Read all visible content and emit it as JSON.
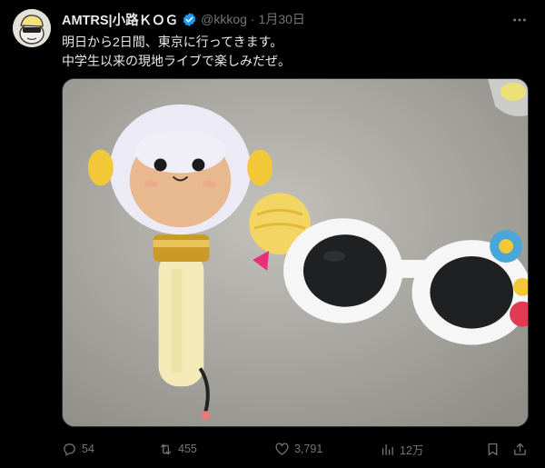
{
  "user": {
    "display_name": "AMTRS|小路ＫＯＧ",
    "handle": "@kkkog",
    "separator": "·",
    "date": "1月30日"
  },
  "tweet": {
    "lines": [
      "明日から2日間、東京に行ってきます。",
      "中学生以来の現地ライブで楽しみだぜ。"
    ]
  },
  "actions": {
    "reply_count": "54",
    "retweet_count": "455",
    "like_count": "3,791",
    "views_count": "12万"
  },
  "icons": {
    "verified": "verified-badge-icon",
    "more": "more-dots-icon",
    "reply": "reply-icon",
    "retweet": "retweet-icon",
    "like": "heart-icon",
    "views": "views-icon",
    "bookmark": "bookmark-icon",
    "share": "share-icon"
  },
  "colors": {
    "background": "#000000",
    "text_primary": "#e7e9ea",
    "text_secondary": "#71767b",
    "verified_blue": "#1d9bf0"
  }
}
